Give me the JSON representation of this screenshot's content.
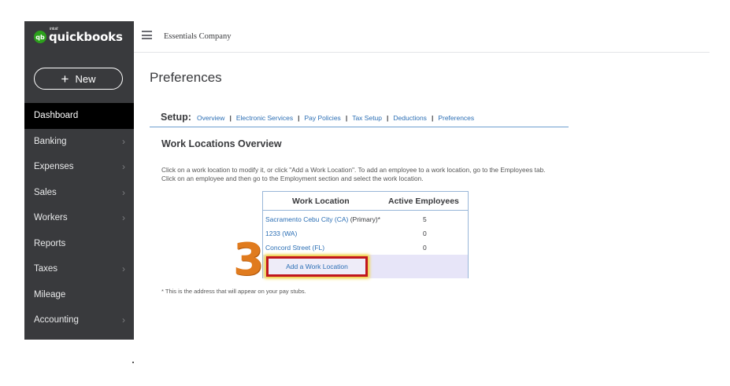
{
  "app": {
    "logo_sub": "intuit",
    "logo_text": "quickbooks",
    "logo_mark": "qb",
    "new_button": "New",
    "company_name": "Essentials Company"
  },
  "sidebar": {
    "items": [
      {
        "label": "Dashboard",
        "chevron": false,
        "active": true
      },
      {
        "label": "Banking",
        "chevron": true
      },
      {
        "label": "Expenses",
        "chevron": true
      },
      {
        "label": "Sales",
        "chevron": true
      },
      {
        "label": "Workers",
        "chevron": true
      },
      {
        "label": "Reports",
        "chevron": false
      },
      {
        "label": "Taxes",
        "chevron": true
      },
      {
        "label": "Mileage",
        "chevron": false
      },
      {
        "label": "Accounting",
        "chevron": true
      }
    ]
  },
  "page": {
    "title": "Preferences",
    "setup_label": "Setup:",
    "setup_links": [
      "Overview",
      "Electronic Services",
      "Pay Policies",
      "Tax Setup",
      "Deductions",
      "Preferences"
    ],
    "section_title": "Work Locations Overview",
    "description_line1": "Click on a work location to modify it, or click \"Add a Work Location\". To add an employee to a work location, go to the Employees tab.",
    "description_line2": "Click on an employee and then go to the Employment section and select the work location.",
    "table": {
      "col_location": "Work Location",
      "col_employees": "Active Employees",
      "rows": [
        {
          "location": "Sacramento Cebu City (CA)",
          "suffix": " (Primary)*",
          "employees": "5"
        },
        {
          "location": "1233 (WA)",
          "suffix": "",
          "employees": "0"
        },
        {
          "location": "Concord Street (FL)",
          "suffix": "",
          "employees": "0"
        }
      ],
      "add_button": "Add a Work Location"
    },
    "footnote": "* This is the address that will appear on your pay stubs.",
    "step_number": "3"
  },
  "colors": {
    "sidebar_bg": "#393a3d",
    "link_blue": "#2c6fb5",
    "brand_green": "#2ca01c",
    "highlight_red": "#c0161e",
    "step_orange": "#e07b1e"
  }
}
